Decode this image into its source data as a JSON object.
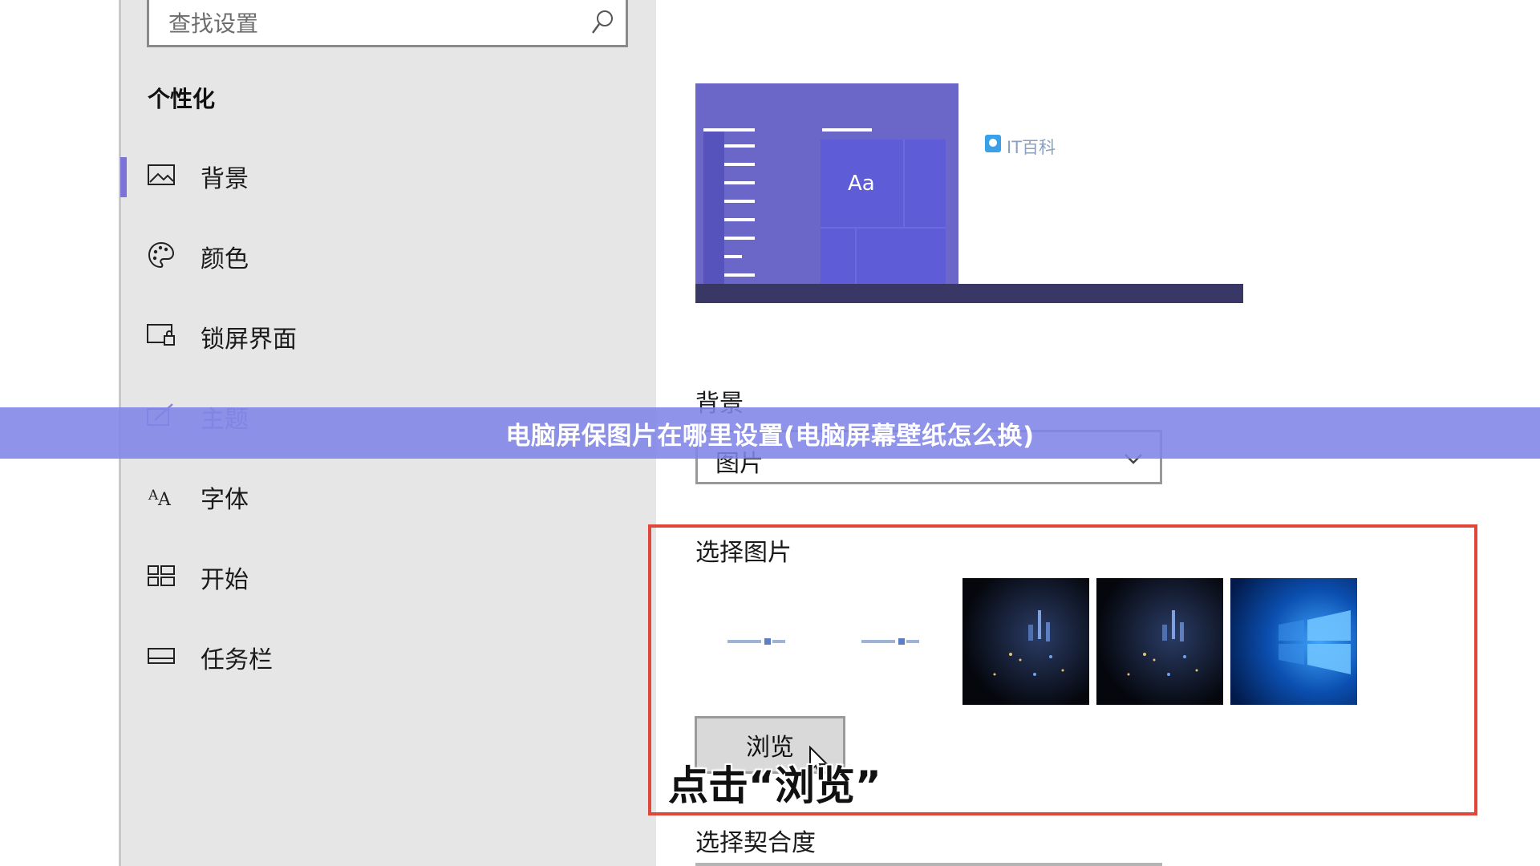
{
  "search": {
    "placeholder": "查找设置"
  },
  "sidebar": {
    "title": "个性化",
    "items": [
      {
        "label": "背景",
        "icon": "image-icon"
      },
      {
        "label": "颜色",
        "icon": "palette-icon"
      },
      {
        "label": "锁屏界面",
        "icon": "lock-screen-icon"
      },
      {
        "label": "主题",
        "icon": "theme-brush-icon"
      },
      {
        "label": "字体",
        "icon": "font-icon"
      },
      {
        "label": "开始",
        "icon": "start-icon"
      },
      {
        "label": "任务栏",
        "icon": "taskbar-icon"
      }
    ]
  },
  "preview": {
    "sample_text": "Aa",
    "watermark": "IT百科",
    "accent_color": "#6b67c9",
    "taskbar_color": "#383766"
  },
  "background": {
    "label": "背景",
    "dropdown_value": "图片"
  },
  "banner": {
    "text": "电脑屏保图片在哪里设置(电脑屏幕壁纸怎么换)"
  },
  "choose_picture": {
    "label": "选择图片",
    "browse_label": "浏览"
  },
  "caption": {
    "text": "点击“浏览”"
  },
  "fit": {
    "label": "选择契合度"
  },
  "colors": {
    "active_indicator": "#7b73d8",
    "highlight_box": "#e0473b",
    "banner_bg": "#8084e6"
  }
}
